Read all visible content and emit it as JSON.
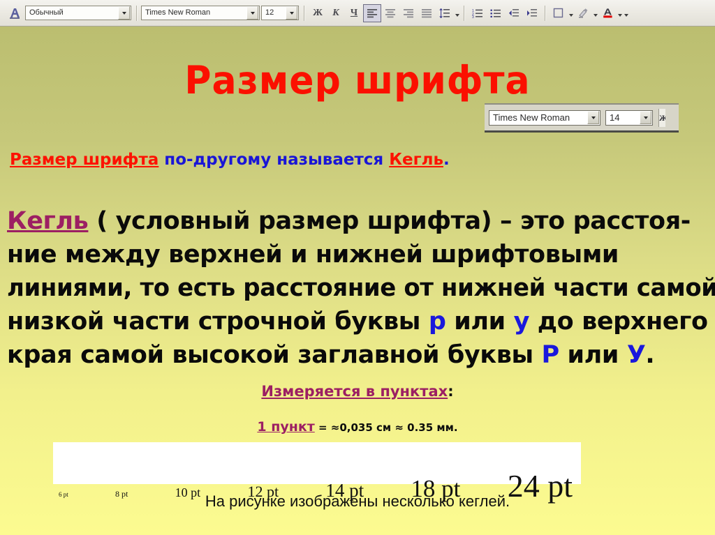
{
  "toolbar": {
    "style_icon": "paragraph-style-icon",
    "style_value": "Обычный",
    "font_value": "Times New Roman",
    "size_value": "12",
    "bold_label": "Ж",
    "italic_label": "К",
    "underline_label": "Ч",
    "align_left": "align-left-icon",
    "align_center": "align-center-icon",
    "align_right": "align-right-icon",
    "align_justify": "align-justify-icon",
    "line_spacing": "line-spacing-icon",
    "numbered_list": "numbered-list-icon",
    "bulleted_list": "bulleted-list-icon",
    "decrease_indent": "decrease-indent-icon",
    "increase_indent": "increase-indent-icon",
    "borders": "borders-icon",
    "highlight": "highlight-icon",
    "font_color": "font-color-icon"
  },
  "slide": {
    "title": "Размер шрифта",
    "inset": {
      "font_value": "Times New Roman",
      "size_value": "14",
      "edge_label": "Ж"
    },
    "subtitle": {
      "part1": "Размер шрифта",
      "part2": " по-другому называется ",
      "part3": "Кегль",
      "part4": "."
    },
    "body": {
      "kegl": "Кегль",
      "line1_rest": " ( условный размер шрифта) – это расстоя-",
      "line2": "ние между верхней и нижней шрифтовыми",
      "line3": "линиями, то есть расстояние от нижней части самой",
      "line4_a": "низкой части строчной буквы ",
      "line4_b": "р",
      "line4_c": " или ",
      "line4_d": "у",
      "line4_e": " до верхнего",
      "line5_a": "края самой высокой заглавной буквы ",
      "line5_b": "Р",
      "line5_c": " или ",
      "line5_d": "У",
      "line5_e": "."
    },
    "measure_label": "Измеряется в пунктах",
    "measure_colon": ":",
    "one_point_label": "1 пункт",
    "one_point_value": " = ≈0,035 см ≈ 0.35 мм.",
    "pt_samples": [
      "6 pt",
      "8 pt",
      "10 pt",
      "12 pt",
      "14 pt",
      "18 pt",
      "24 pt"
    ],
    "caption": "На рисунке изображены несколько кеглей."
  },
  "colors": {
    "title_red": "#fb1000",
    "accent_blue": "#1a16d6",
    "accent_purple": "#9c1f63",
    "bg_top": "#bbbe70",
    "bg_bottom": "#fcfb90"
  }
}
